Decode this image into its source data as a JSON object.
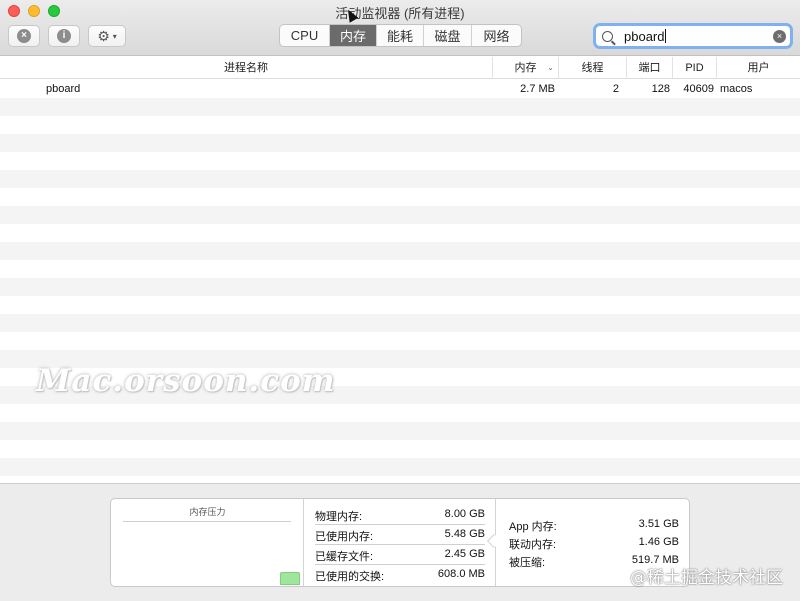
{
  "window": {
    "title": "活动监视器 (所有进程)"
  },
  "toolbar": {
    "stop_icon": "x-circle-icon",
    "info_icon": "info-circle-icon",
    "gear_icon": "gear-icon",
    "stop_glyph": "×",
    "info_glyph": "i",
    "gear_glyph": "⚙",
    "chevron_glyph": "▾",
    "tabs": [
      {
        "label": "CPU",
        "active": false
      },
      {
        "label": "内存",
        "active": true
      },
      {
        "label": "能耗",
        "active": false
      },
      {
        "label": "磁盘",
        "active": false
      },
      {
        "label": "网络",
        "active": false
      }
    ]
  },
  "search": {
    "value": "pboard",
    "clear_glyph": "×"
  },
  "table": {
    "columns": {
      "name": "进程名称",
      "memory": "内存",
      "threads": "线程",
      "ports": "端口",
      "pid": "PID",
      "user": "用户"
    },
    "sort_glyph": "⌄",
    "rows": [
      {
        "name": "pboard",
        "memory": "2.7 MB",
        "threads": "2",
        "ports": "128",
        "pid": "40609",
        "user": "macos"
      }
    ]
  },
  "watermark": "Mac.orsoon.com",
  "memory_panel": {
    "pressure_title": "内存压力",
    "pressure_level": 0.2,
    "stats": [
      {
        "label": "物理内存:",
        "value": "8.00 GB"
      },
      {
        "label": "已使用内存:",
        "value": "5.48 GB"
      },
      {
        "label": "已缓存文件:",
        "value": "2.45 GB"
      },
      {
        "label": "已使用的交换:",
        "value": "608.0 MB"
      }
    ],
    "app_stats": [
      {
        "label": "App 内存:",
        "value": "3.51 GB"
      },
      {
        "label": "联动内存:",
        "value": "1.46 GB"
      },
      {
        "label": "被压缩:",
        "value": "519.7 MB"
      }
    ]
  },
  "credit": "@稀土掘金技术社区",
  "colors": {
    "active_tab": "#6b6b6b",
    "search_focus": "#7fb0f0",
    "pressure_green": "#9fe59b"
  }
}
